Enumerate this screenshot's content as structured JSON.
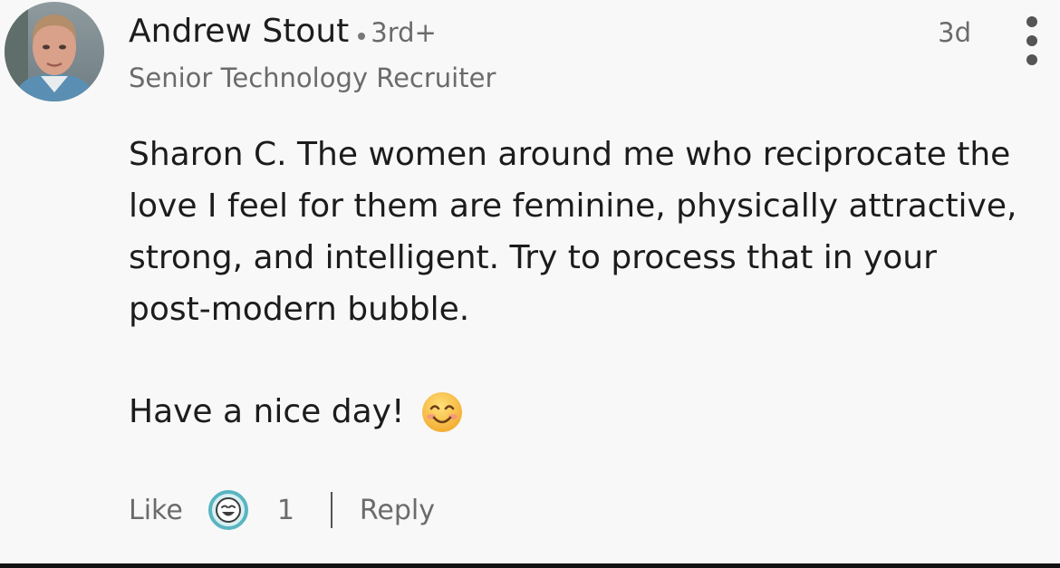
{
  "comment": {
    "author": {
      "name": "Andrew Stout",
      "connection_degree": "3rd+",
      "headline": "Senior Technology Recruiter",
      "avatar_icon": "person-photo"
    },
    "timestamp": "3d",
    "menu_icon": "more-vertical-icon",
    "body_lines": [
      "Sharon C. The women around me who reciprocate the",
      "love I feel for them are feminine, physically attractive,",
      "strong, and intelligent.  Try to process that in your",
      "post-modern bubble."
    ],
    "closing": "Have a nice day!",
    "closing_emoji": "smiling-face-icon",
    "actions": {
      "like_label": "Like",
      "reaction_icon": "laughing-reaction-icon",
      "reaction_count": "1",
      "reply_label": "Reply"
    }
  },
  "colors": {
    "background": "#f8f8f8",
    "primary_text": "#1c1c1c",
    "secondary_text": "#6b6b6b",
    "reaction_ring": "#5ab5c0",
    "emoji_yellow": "#f7c244"
  }
}
